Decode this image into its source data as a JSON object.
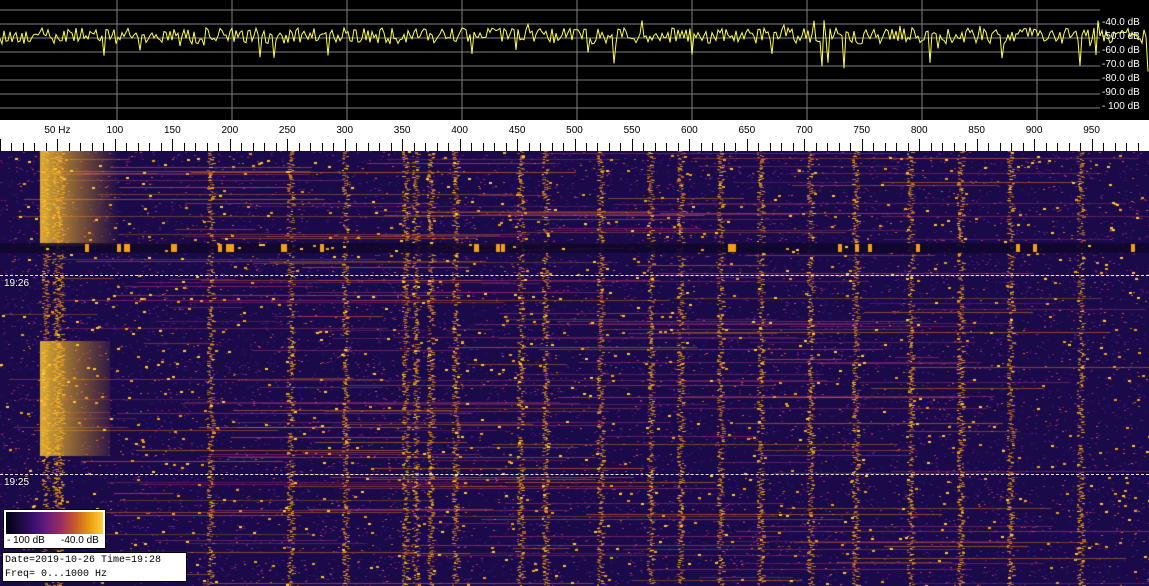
{
  "spectrum": {
    "db_labels": [
      "-40.0 dB",
      "-50.0 dB",
      "-60.0 dB",
      "-70.0 dB",
      "-80.0 dB",
      "-90.0 dB",
      "- 100 dB"
    ],
    "trace_color": "#ffff40",
    "grid_color": "#808080"
  },
  "ruler": {
    "ticks": [
      "50 Hz",
      "100",
      "150",
      "200",
      "250",
      "300",
      "350",
      "400",
      "450",
      "500",
      "550",
      "600",
      "650",
      "700",
      "750",
      "800",
      "850",
      "900",
      "950"
    ],
    "freq_range_hz": [
      0,
      1000
    ]
  },
  "waterfall": {
    "time_markers": [
      "19:26",
      "19:25"
    ],
    "palette": [
      "#1a0a4a",
      "#3a1470",
      "#6a1d7a",
      "#a0306a",
      "#d06a20",
      "#f0a010",
      "#ffc830"
    ]
  },
  "colorbar": {
    "min_label": "- 100 dB",
    "max_label": "-40.0 dB"
  },
  "info": {
    "line1": "Date=2019-10-26 Time=19:28",
    "line2": "Freq= 0...1000 Hz"
  }
}
